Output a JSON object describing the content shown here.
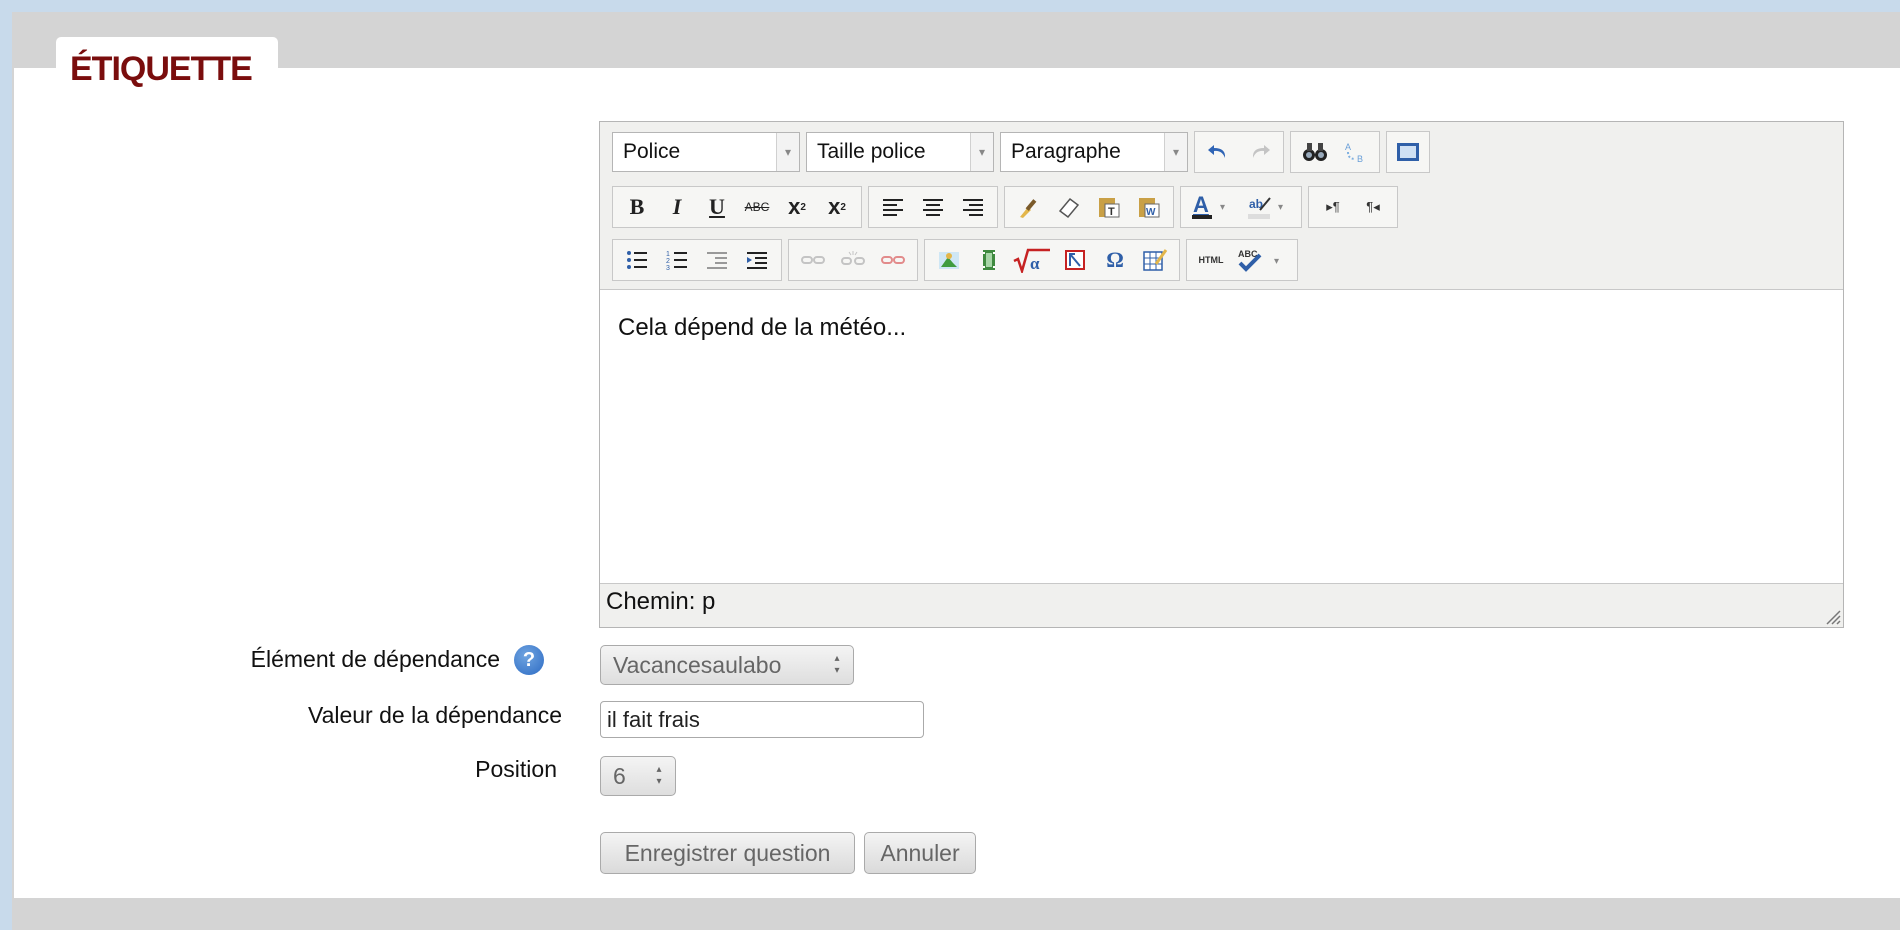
{
  "section": {
    "title": "ÉTIQUETTE"
  },
  "editor": {
    "font_select": "Police",
    "size_select": "Taille police",
    "format_select": "Paragraphe",
    "content": "Cela dépend de la météo...",
    "path": "Chemin: p",
    "toolbar_icons": [
      "undo-icon",
      "redo-icon",
      "find-icon",
      "replace-icon",
      "fullscreen-icon",
      "bold-icon",
      "italic-icon",
      "underline-icon",
      "strikethrough-icon",
      "subscript-icon",
      "superscript-icon",
      "align-left-icon",
      "align-center-icon",
      "align-right-icon",
      "cleanup-icon",
      "eraser-icon",
      "paste-text-icon",
      "paste-word-icon",
      "text-color-icon",
      "highlight-color-icon",
      "ltr-icon",
      "rtl-icon",
      "bullet-list-icon",
      "numbered-list-icon",
      "outdent-icon",
      "indent-icon",
      "link-icon",
      "unlink-icon",
      "anchor-icon",
      "image-icon",
      "media-icon",
      "equation-icon",
      "nolink-icon",
      "special-char-icon",
      "table-icon",
      "html-icon",
      "spellcheck-icon"
    ]
  },
  "form": {
    "dependency_label": "Élément de dépendance",
    "dependency_value": "Vacancesaulabo",
    "dependency_value_label": "Valeur de la dépendance",
    "dependency_value_input": "il fait frais",
    "position_label": "Position",
    "position_value": "6",
    "save_button": "Enregistrer question",
    "cancel_button": "Annuler"
  },
  "colors": {
    "title": "#7a0d0d",
    "background": "#c8daeb",
    "help": "#2d6bc4"
  }
}
